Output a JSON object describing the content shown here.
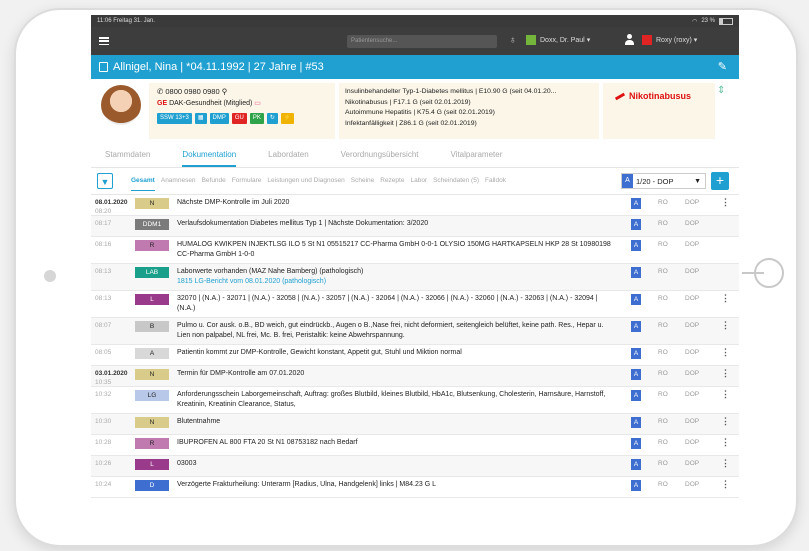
{
  "status": {
    "time": "11:06",
    "date": "Freitag 31. Jan.",
    "battery": "23 %"
  },
  "topbar": {
    "search_placeholder": "Patientensuche...",
    "doctor": "Doxx, Dr. Paul",
    "doctor_color": "#74b63b",
    "user": "Roxy (roxy)",
    "user_color": "#e02424"
  },
  "patient": {
    "header": "Allnigel, Nina | *04.11.1992 | 27 Jahre | #53",
    "phone": "0800 0980 0980",
    "insurance_badge": "GE",
    "insurance": "DAK-Gesundheit (Mitglied)",
    "tags": [
      {
        "label": "SSW 13+3",
        "color": "#1fa0d0"
      },
      {
        "label": "▦",
        "color": "#1fa0d0"
      },
      {
        "label": "DMP",
        "color": "#1fa0d0"
      },
      {
        "label": "GU",
        "color": "#e02424"
      },
      {
        "label": "PK",
        "color": "#2fa34a"
      },
      {
        "label": "↻",
        "color": "#1fa0d0"
      },
      {
        "label": "⚡",
        "color": "#f0b400"
      }
    ],
    "diagnoses": [
      "Insulinbehandelter Typ-1-Diabetes mellitus | E10.90 G (seit 04.01.20...",
      "Nikotinabusus | F17.1 G (seit 02.01.2019)",
      "Autoimmune Hepatitis | K75.4 G (seit 02.01.2019)",
      "Infektanfälligkeit | Z86.1 G (seit 02.01.2019)"
    ],
    "warning": "Nikotinabusus"
  },
  "tabs": [
    "Stammdaten",
    "Dokumentation",
    "Labordaten",
    "Verordnungsübersicht",
    "Vitalparameter"
  ],
  "active_tab": 1,
  "subtabs": [
    "Gesamt",
    "Anamnesen",
    "Befunde",
    "Formulare",
    "Leistungen und Diagnosen",
    "Scheine",
    "Rezepte",
    "Labor",
    "Scheindaten (5)",
    "Falldok"
  ],
  "selector": {
    "badge": "A",
    "value": "1/20 - DOP"
  },
  "rows": [
    {
      "date": "08.01.2020",
      "time": "08:20",
      "type": "N",
      "type_color": "#d9cc8a",
      "text": "Nächste DMP-Kontrolle im Juli 2020",
      "sub": "",
      "more": true
    },
    {
      "date": "",
      "time": "08:17",
      "type": "DDM1",
      "type_color": "#7b7b7b",
      "text": "Verlaufsdokumentation Diabetes mellitus Typ 1 | Nächste Dokumentation: 3/2020",
      "sub": "",
      "more": false
    },
    {
      "date": "",
      "time": "08:16",
      "type": "R",
      "type_color": "#c07ab0",
      "text": "HUMALOG KWIKPEN INJEKTLSG ILO 5 St N1 05515217 CC-Pharma GmbH 0-0-1 OLYSIO 150MG HARTKAPSELN HKP 28 St 10980198 CC-Pharma GmbH 1-0-0",
      "sub": "",
      "more": false
    },
    {
      "date": "",
      "time": "08:13",
      "type": "LAB",
      "type_color": "#1aa08a",
      "text": "Laborwerte vorhanden (MAZ Nahe Bamberg) (pathologisch)",
      "sub": "1815 LG-Bericht vom 08.01.2020 (pathologisch)",
      "more": false
    },
    {
      "date": "",
      "time": "08:13",
      "type": "L",
      "type_color": "#9a3a8a",
      "text": "32070 | (N.A.) - 32071 | (N.A.) - 32058 | (N.A.) - 32057 | (N.A.) - 32064 | (N.A.) - 32066 | (N.A.) - 32060 | (N.A.) - 32063 | (N.A.) - 32094 | (N.A.)",
      "sub": "",
      "more": true
    },
    {
      "date": "",
      "time": "08:07",
      "type": "B",
      "type_color": "#c8c8c8",
      "text": "Pulmo u. Cor ausk. o.B., BD weich, gut eindrückb., Augen o B.,Nase frei, nicht deformiert, seitengleich belüftet, keine path. Res., Hepar u. Lien non palpabel, NL frei, Mc. B. frei, Peristaltik: keine Abwehrspannung.",
      "sub": "",
      "more": true
    },
    {
      "date": "",
      "time": "08:05",
      "type": "A",
      "type_color": "#d8d8d8",
      "text": "Patientin kommt zur DMP-Kontrolle, Gewicht konstant, Appetit gut, Stuhl und Miktion normal",
      "sub": "",
      "more": true
    },
    {
      "date": "03.01.2020",
      "time": "10:35",
      "type": "N",
      "type_color": "#d9cc8a",
      "text": "Termin für DMP-Kontrolle am 07.01.2020",
      "sub": "",
      "more": true
    },
    {
      "date": "",
      "time": "10:32",
      "type": "LG",
      "type_color": "#b8c8e8",
      "text": "Anforderungsschein Laborgemeinschaft, Auftrag: großes Blutbild, kleines Blutbild, HbA1c, Blutsenkung, Cholesterin, Harnsäure, Harnstoff, Kreatinin, Kreatinin Clearance, Status,",
      "sub": "",
      "more": true
    },
    {
      "date": "",
      "time": "10:30",
      "type": "N",
      "type_color": "#d9cc8a",
      "text": "Blutentnahme",
      "sub": "",
      "more": true
    },
    {
      "date": "",
      "time": "10:28",
      "type": "R",
      "type_color": "#c07ab0",
      "text": "IBUPROFEN AL 800 FTA 20 St N1 08753182 nach Bedarf",
      "sub": "",
      "more": true
    },
    {
      "date": "",
      "time": "10:26",
      "type": "L",
      "type_color": "#9a3a8a",
      "text": "03003",
      "sub": "",
      "more": true
    },
    {
      "date": "",
      "time": "10:24",
      "type": "D",
      "type_color": "#3e6fd0",
      "text": "Verzögerte Frakturheilung: Unterarm [Radius, Ulna, Handgelenk] links | M84.23 G L",
      "sub": "",
      "more": true
    }
  ],
  "row_cols": {
    "a": "A",
    "ro": "RO",
    "dop": "DOP"
  }
}
